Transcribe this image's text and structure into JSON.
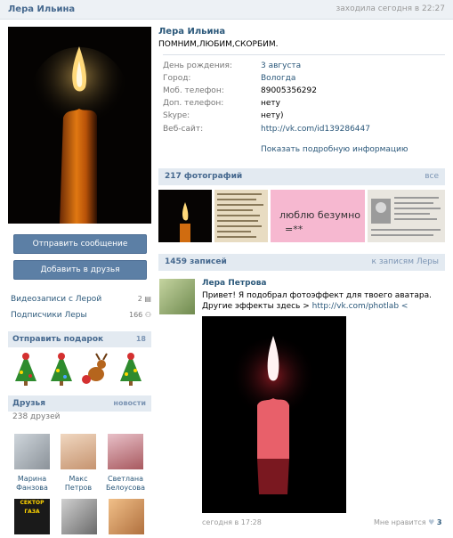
{
  "header": {
    "name": "Лера Ильина",
    "last_seen": "заходила сегодня в 22:27"
  },
  "profile": {
    "name": "Лера Ильина",
    "status": "ПОМНИМ,ЛЮБИМ,СКОРБИМ.",
    "info": [
      {
        "label": "День рождения:",
        "value": "3 августа"
      },
      {
        "label": "Город:",
        "value": "Вологда"
      },
      {
        "label": "Моб. телефон:",
        "value": "89005356292"
      },
      {
        "label": "Доп. телефон:",
        "value": "нету"
      },
      {
        "label": "Skype:",
        "value": "нету)"
      },
      {
        "label": "Веб-сайт:",
        "value": "http://vk.com/id139286447"
      }
    ],
    "show_more": "Показать подробную информацию"
  },
  "buttons": {
    "message": "Отправить сообщение",
    "add_friend": "Добавить в друзья"
  },
  "side_links": [
    {
      "label": "Видеозаписи с Лерой",
      "count": "2"
    },
    {
      "label": "Подписчики Леры",
      "count": "166"
    }
  ],
  "gifts": {
    "title": "Отправить подарок",
    "count": "18"
  },
  "friends": {
    "title": "Друзья",
    "news": "новости",
    "count_text": "238 друзей",
    "list": [
      {
        "first": "Марина",
        "last": "Фанзова"
      },
      {
        "first": "Макс",
        "last": "Петров"
      },
      {
        "first": "Светлана",
        "last": "Белоусова"
      }
    ],
    "extra_label": "СЕКТОР ГАЗА"
  },
  "photos": {
    "title": "217 фотографий",
    "all": "все",
    "pink_text_1": "люблю безумно",
    "pink_text_2": "=**"
  },
  "wall": {
    "title": "1459 записей",
    "to_wall": "к записям Леры",
    "post_author": "Лера Петрова",
    "post_text": "Привет! Я подобрал фотоэффект для твоего аватара. Другие эффекты здесь > ",
    "post_link": "http://vk.com/photlab <",
    "post_time": "сегодня в 17:28",
    "like_label": "Мне нравится",
    "like_count": "3"
  },
  "colors": {
    "link": "#2b587a",
    "header_bg": "#e3eaf1",
    "button": "#5c7fa5",
    "pink": "#f6b8d0"
  }
}
